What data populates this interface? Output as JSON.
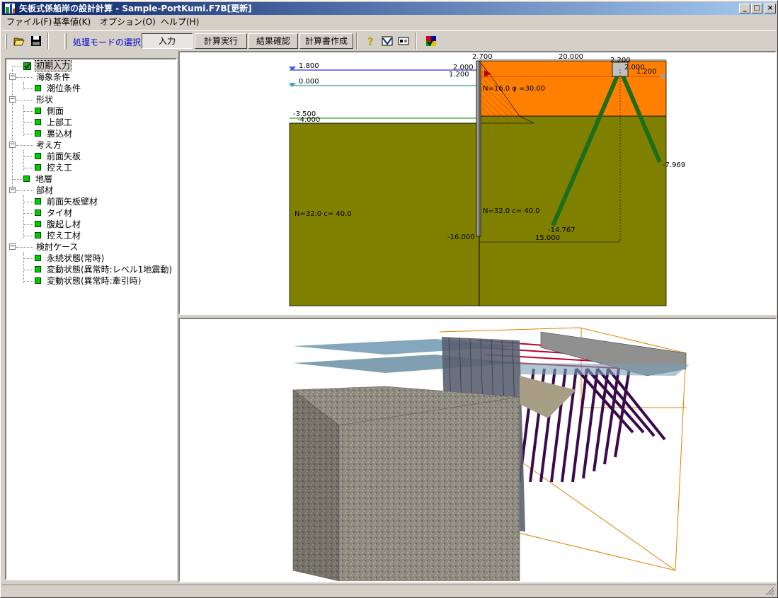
{
  "window": {
    "title": "矢板式係船岸の設計計算 - Sample-PortKumi.F7B[更新]",
    "controls": [
      "_",
      "□",
      "×"
    ]
  },
  "menu": [
    "ファイル(F)",
    "基準値(K)",
    "オプション(O)",
    "ヘルプ(H)"
  ],
  "toolbar": {
    "mode_label": "処理モードの選択",
    "modes": [
      "入力",
      "計算実行",
      "結果確認",
      "計算書作成"
    ],
    "active_mode": "入力"
  },
  "tree": {
    "root": "初期入力",
    "items": [
      {
        "label": "海象条件",
        "level": 1,
        "type": "group"
      },
      {
        "label": "潮位条件",
        "level": 2,
        "type": "leaf"
      },
      {
        "label": "形状",
        "level": 1,
        "type": "group"
      },
      {
        "label": "側面",
        "level": 2,
        "type": "leaf"
      },
      {
        "label": "上部工",
        "level": 2,
        "type": "leaf"
      },
      {
        "label": "裏込材",
        "level": 2,
        "type": "leaf"
      },
      {
        "label": "考え方",
        "level": 1,
        "type": "group"
      },
      {
        "label": "前面矢板",
        "level": 2,
        "type": "leaf"
      },
      {
        "label": "控え工",
        "level": 2,
        "type": "leaf"
      },
      {
        "label": "地層",
        "level": 1,
        "type": "leaf"
      },
      {
        "label": "部材",
        "level": 1,
        "type": "group"
      },
      {
        "label": "前面矢板壁材",
        "level": 2,
        "type": "leaf"
      },
      {
        "label": "タイ材",
        "level": 2,
        "type": "leaf"
      },
      {
        "label": "腹起し材",
        "level": 2,
        "type": "leaf"
      },
      {
        "label": "控え工材",
        "level": 2,
        "type": "leaf"
      },
      {
        "label": "検討ケース",
        "level": 1,
        "type": "group"
      },
      {
        "label": "永続状態(常時)",
        "level": 2,
        "type": "leaf"
      },
      {
        "label": "変動状態(異常時:レベル1地震動)",
        "level": 2,
        "type": "leaf"
      },
      {
        "label": "変動状態(異常時:牽引時)",
        "level": 2,
        "type": "leaf"
      }
    ]
  },
  "drawing": {
    "top_dims": {
      "a": "2.700",
      "b": "20.000",
      "c": "2.200",
      "d": "2.000"
    },
    "levels": {
      "hwl": "1.800",
      "lwl": "0.000",
      "seabed1": "-3.500",
      "seabed2": "-4.000",
      "pile_tip": "-16.000",
      "crown": "2.000",
      "crown2": "1.200",
      "anchor_tip_r": "-7.969",
      "anchor_tip_l": "-14.767",
      "anchor_dist": "15.000",
      "anchor_cap": "1.200"
    },
    "soil_front": "N=32.0 c=  40.0",
    "soil_back": "N=32.0 c=  40.0",
    "backfill": "N=16.0  φ =30.00",
    "colors": {
      "soil": "#808000",
      "backfill": "#ff8000",
      "anchor": "#1c6e1c",
      "water": "#0000c0"
    }
  }
}
